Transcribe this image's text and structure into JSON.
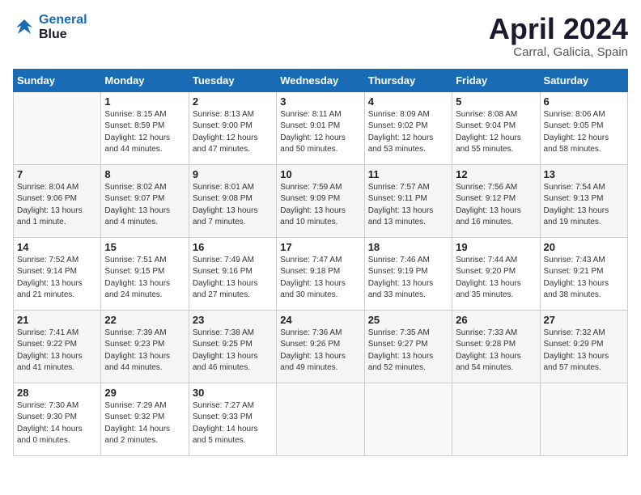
{
  "header": {
    "logo_line1": "General",
    "logo_line2": "Blue",
    "title": "April 2024",
    "location": "Carral, Galicia, Spain"
  },
  "days_of_week": [
    "Sunday",
    "Monday",
    "Tuesday",
    "Wednesday",
    "Thursday",
    "Friday",
    "Saturday"
  ],
  "weeks": [
    [
      {
        "num": "",
        "info": ""
      },
      {
        "num": "1",
        "info": "Sunrise: 8:15 AM\nSunset: 8:59 PM\nDaylight: 12 hours\nand 44 minutes."
      },
      {
        "num": "2",
        "info": "Sunrise: 8:13 AM\nSunset: 9:00 PM\nDaylight: 12 hours\nand 47 minutes."
      },
      {
        "num": "3",
        "info": "Sunrise: 8:11 AM\nSunset: 9:01 PM\nDaylight: 12 hours\nand 50 minutes."
      },
      {
        "num": "4",
        "info": "Sunrise: 8:09 AM\nSunset: 9:02 PM\nDaylight: 12 hours\nand 53 minutes."
      },
      {
        "num": "5",
        "info": "Sunrise: 8:08 AM\nSunset: 9:04 PM\nDaylight: 12 hours\nand 55 minutes."
      },
      {
        "num": "6",
        "info": "Sunrise: 8:06 AM\nSunset: 9:05 PM\nDaylight: 12 hours\nand 58 minutes."
      }
    ],
    [
      {
        "num": "7",
        "info": "Sunrise: 8:04 AM\nSunset: 9:06 PM\nDaylight: 13 hours\nand 1 minute."
      },
      {
        "num": "8",
        "info": "Sunrise: 8:02 AM\nSunset: 9:07 PM\nDaylight: 13 hours\nand 4 minutes."
      },
      {
        "num": "9",
        "info": "Sunrise: 8:01 AM\nSunset: 9:08 PM\nDaylight: 13 hours\nand 7 minutes."
      },
      {
        "num": "10",
        "info": "Sunrise: 7:59 AM\nSunset: 9:09 PM\nDaylight: 13 hours\nand 10 minutes."
      },
      {
        "num": "11",
        "info": "Sunrise: 7:57 AM\nSunset: 9:11 PM\nDaylight: 13 hours\nand 13 minutes."
      },
      {
        "num": "12",
        "info": "Sunrise: 7:56 AM\nSunset: 9:12 PM\nDaylight: 13 hours\nand 16 minutes."
      },
      {
        "num": "13",
        "info": "Sunrise: 7:54 AM\nSunset: 9:13 PM\nDaylight: 13 hours\nand 19 minutes."
      }
    ],
    [
      {
        "num": "14",
        "info": "Sunrise: 7:52 AM\nSunset: 9:14 PM\nDaylight: 13 hours\nand 21 minutes."
      },
      {
        "num": "15",
        "info": "Sunrise: 7:51 AM\nSunset: 9:15 PM\nDaylight: 13 hours\nand 24 minutes."
      },
      {
        "num": "16",
        "info": "Sunrise: 7:49 AM\nSunset: 9:16 PM\nDaylight: 13 hours\nand 27 minutes."
      },
      {
        "num": "17",
        "info": "Sunrise: 7:47 AM\nSunset: 9:18 PM\nDaylight: 13 hours\nand 30 minutes."
      },
      {
        "num": "18",
        "info": "Sunrise: 7:46 AM\nSunset: 9:19 PM\nDaylight: 13 hours\nand 33 minutes."
      },
      {
        "num": "19",
        "info": "Sunrise: 7:44 AM\nSunset: 9:20 PM\nDaylight: 13 hours\nand 35 minutes."
      },
      {
        "num": "20",
        "info": "Sunrise: 7:43 AM\nSunset: 9:21 PM\nDaylight: 13 hours\nand 38 minutes."
      }
    ],
    [
      {
        "num": "21",
        "info": "Sunrise: 7:41 AM\nSunset: 9:22 PM\nDaylight: 13 hours\nand 41 minutes."
      },
      {
        "num": "22",
        "info": "Sunrise: 7:39 AM\nSunset: 9:23 PM\nDaylight: 13 hours\nand 44 minutes."
      },
      {
        "num": "23",
        "info": "Sunrise: 7:38 AM\nSunset: 9:25 PM\nDaylight: 13 hours\nand 46 minutes."
      },
      {
        "num": "24",
        "info": "Sunrise: 7:36 AM\nSunset: 9:26 PM\nDaylight: 13 hours\nand 49 minutes."
      },
      {
        "num": "25",
        "info": "Sunrise: 7:35 AM\nSunset: 9:27 PM\nDaylight: 13 hours\nand 52 minutes."
      },
      {
        "num": "26",
        "info": "Sunrise: 7:33 AM\nSunset: 9:28 PM\nDaylight: 13 hours\nand 54 minutes."
      },
      {
        "num": "27",
        "info": "Sunrise: 7:32 AM\nSunset: 9:29 PM\nDaylight: 13 hours\nand 57 minutes."
      }
    ],
    [
      {
        "num": "28",
        "info": "Sunrise: 7:30 AM\nSunset: 9:30 PM\nDaylight: 14 hours\nand 0 minutes."
      },
      {
        "num": "29",
        "info": "Sunrise: 7:29 AM\nSunset: 9:32 PM\nDaylight: 14 hours\nand 2 minutes."
      },
      {
        "num": "30",
        "info": "Sunrise: 7:27 AM\nSunset: 9:33 PM\nDaylight: 14 hours\nand 5 minutes."
      },
      {
        "num": "",
        "info": ""
      },
      {
        "num": "",
        "info": ""
      },
      {
        "num": "",
        "info": ""
      },
      {
        "num": "",
        "info": ""
      }
    ]
  ]
}
